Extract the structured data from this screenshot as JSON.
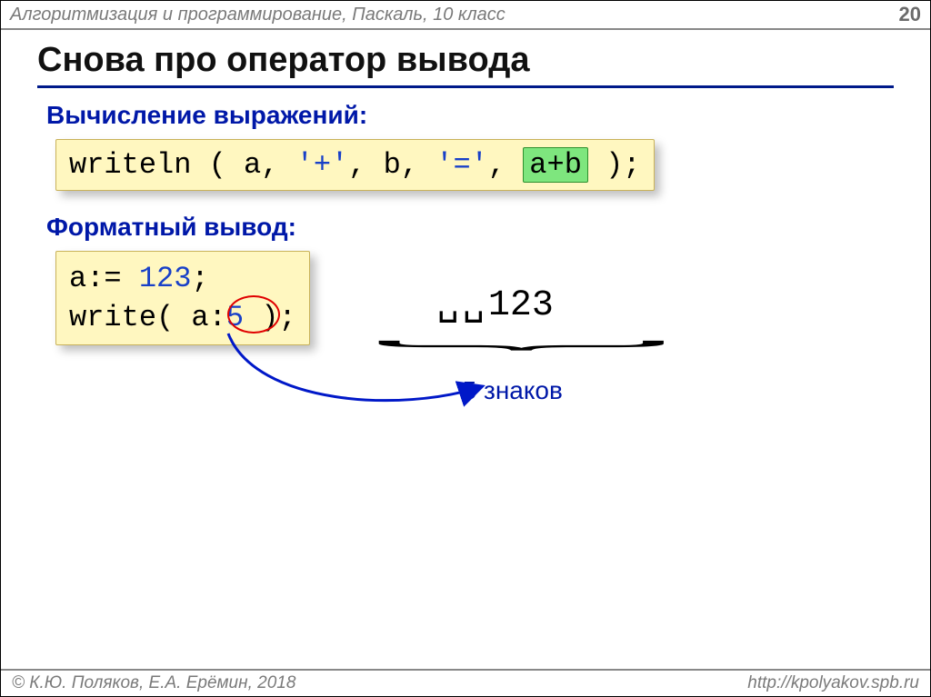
{
  "header": {
    "course": "Алгоритмизация и программирование, Паскаль, 10 класс",
    "page": "20"
  },
  "title": "Снова про оператор вывода",
  "sections": {
    "expr_label": "Вычисление выражений:",
    "format_label": "Форматный вывод:"
  },
  "code1": {
    "pre": "writeln ( a, ",
    "s1": "'+'",
    "mid1": ", b, ",
    "s2": "'='",
    "mid2": ", ",
    "chip": "a+b",
    "post": " );"
  },
  "code2": {
    "line1_pre": "a:= ",
    "line1_num": "123",
    "line1_post": ";",
    "line2_pre": "write( a:",
    "line2_num": "5",
    "line2_post": " );"
  },
  "output": {
    "spaces": "␣␣",
    "value": "123",
    "annotation": "5 знаков"
  },
  "footer": {
    "copyright": "© К.Ю. Поляков, Е.А. Ерёмин, 2018",
    "url": "http://kpolyakov.spb.ru"
  }
}
